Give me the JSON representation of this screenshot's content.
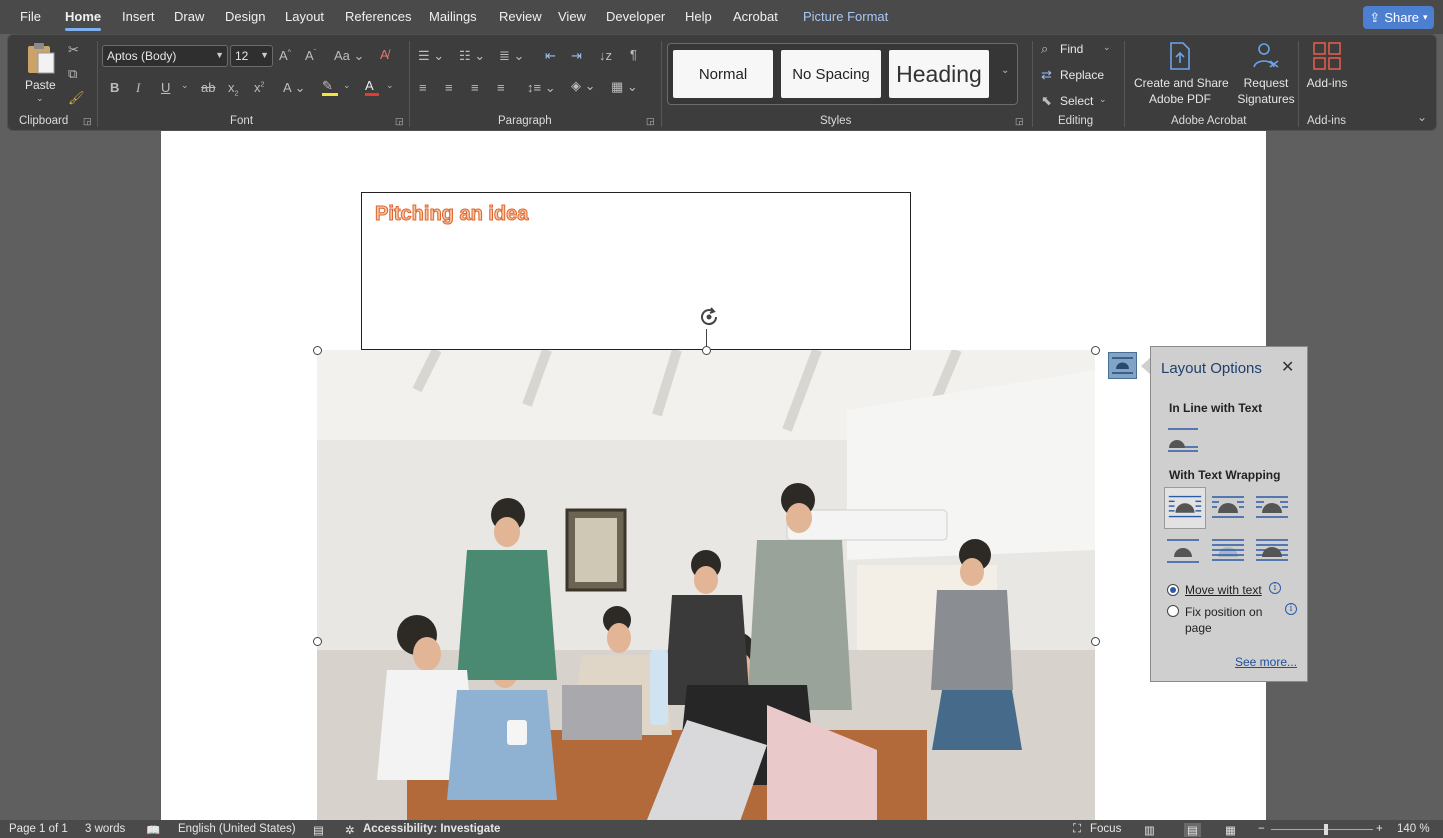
{
  "menubar": {
    "items": [
      "File",
      "Home",
      "Insert",
      "Draw",
      "Design",
      "Layout",
      "References",
      "Mailings",
      "Review",
      "View",
      "Developer",
      "Help",
      "Acrobat",
      "Picture Format"
    ],
    "active": "Home",
    "share_label": "Share"
  },
  "ribbon": {
    "clipboard": {
      "paste_label": "Paste",
      "group_label": "Clipboard"
    },
    "font": {
      "font_name": "Aptos (Body)",
      "font_size": "12",
      "change_case": "Aa",
      "group_label": "Font"
    },
    "paragraph": {
      "group_label": "Paragraph"
    },
    "styles": {
      "items": [
        "Normal",
        "No Spacing",
        "Heading"
      ],
      "group_label": "Styles"
    },
    "editing": {
      "find_label": "Find",
      "replace_label": "Replace",
      "select_label": "Select",
      "group_label": "Editing"
    },
    "acrobat": {
      "create_share_label_1": "Create and Share",
      "create_share_label_2": "Adobe PDF",
      "request_sig_label_1": "Request",
      "request_sig_label_2": "Signatures",
      "group_label": "Adobe Acrobat"
    },
    "addins": {
      "button_label": "Add-ins",
      "group_label": "Add-ins"
    }
  },
  "document": {
    "textbox_title": "Pitching an idea"
  },
  "layout_options": {
    "title": "Layout Options",
    "inline_heading": "In Line with Text",
    "wrapping_heading": "With Text Wrapping",
    "move_with_text": "Move with text",
    "fix_position_1": "Fix position on",
    "fix_position_2": "page",
    "see_more": "See more...",
    "selected_option": "Move with text"
  },
  "statusbar": {
    "page": "Page 1 of 1",
    "words": "3 words",
    "language": "English (United States)",
    "accessibility": "Accessibility: Investigate",
    "focus": "Focus",
    "zoom": "140 %"
  },
  "colors": {
    "accent": "#4d7fd1",
    "title_orange": "#e0632a",
    "font_color_red": "#e8392e",
    "highlight_yellow": "#f7e43a"
  }
}
